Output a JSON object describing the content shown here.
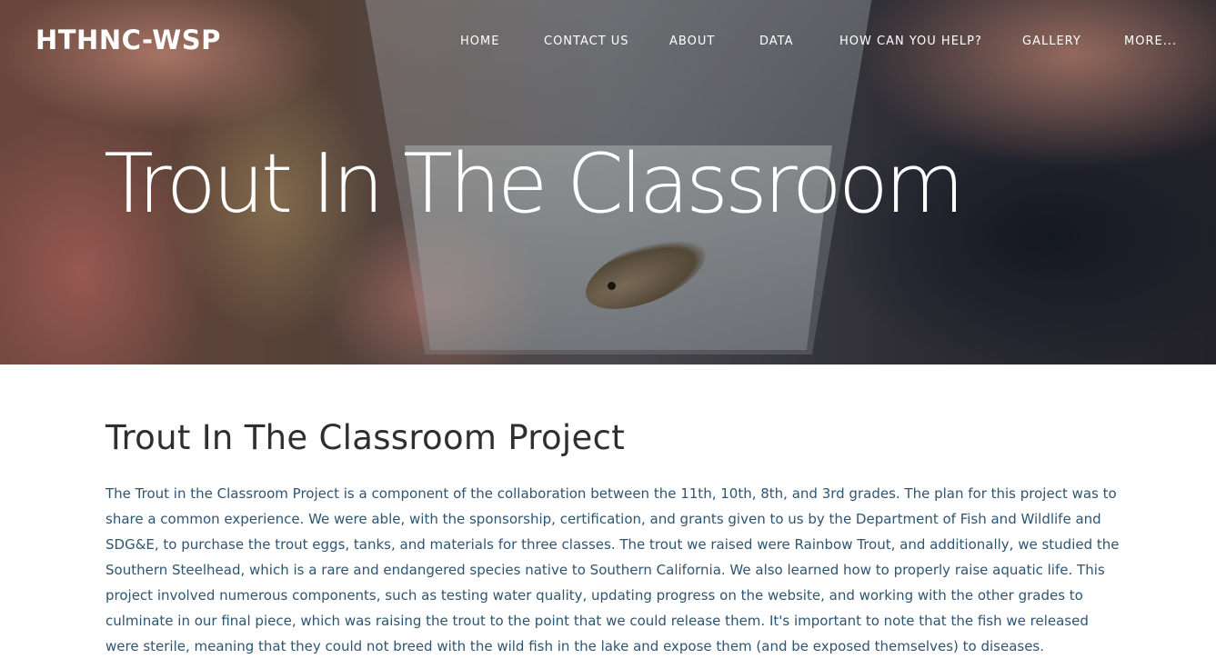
{
  "site": {
    "logo": "HTHNC-WSP"
  },
  "nav": {
    "items": [
      {
        "label": "HOME"
      },
      {
        "label": "CONTACT US"
      },
      {
        "label": "ABOUT"
      },
      {
        "label": "DATA"
      },
      {
        "label": "HOW CAN YOU HELP?"
      },
      {
        "label": "GALLERY"
      },
      {
        "label": "MORE..."
      }
    ]
  },
  "hero": {
    "title": "Trout In The Classroom"
  },
  "main": {
    "section_title": "Trout In The Classroom Project",
    "paragraph": "The Trout in the Classroom Project is a component of the collaboration between the 11th, 10th, 8th, and 3rd grades. The plan for this project was to share a common experience. We were able, with the sponsorship, certification, and grants given to us by the Department of Fish and Wildlife and SDG&E, to purchase the trout eggs, tanks, and materials for three classes. The trout we raised were Rainbow Trout, and additionally, we studied the Southern Steelhead, which is a rare and endangered species native to Southern California. We also learned how to properly raise aquatic life. This project involved numerous components, such as testing water quality, updating progress on the website, and working with the other grades to culminate in our final piece, which was raising the trout to the point that we could release them. It's important to note that the fish we released were sterile, meaning that they could not breed with the wild fish in the lake and expose them (and be exposed themselves) to diseases."
  }
}
